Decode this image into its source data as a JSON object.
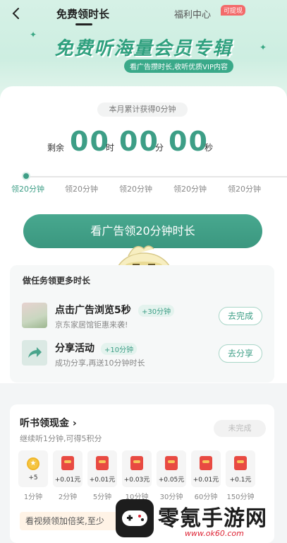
{
  "nav": {
    "back_icon": "chevron-left-icon",
    "tab_free": "免费领时长",
    "tab_welfare": "福利中心",
    "tab_badge": "可提现"
  },
  "banner": {
    "title": "免费听海量会员专辑",
    "subtitle": "看广告攒时长,收听优质VIP内容"
  },
  "timer": {
    "month_total": "本月累计获得0分钟",
    "remaining_label": "剩余",
    "hours": "00",
    "hours_unit": "时",
    "minutes": "00",
    "minutes_unit": "分",
    "seconds": "00",
    "seconds_unit": "秒"
  },
  "progress": {
    "current_step": 0,
    "steps": [
      "领20分钟",
      "领20分钟",
      "领20分钟",
      "领20分钟",
      "领20分钟"
    ]
  },
  "cta_label": "看广告领20分钟时长",
  "tasks": {
    "heading": "做任务领更多时长",
    "items": [
      {
        "title": "点击广告浏览5秒",
        "bonus": "+30分钟",
        "subtitle": "京东家居馆钜惠来袭!",
        "button": "去完成"
      },
      {
        "title": "分享活动",
        "bonus": "+10分钟",
        "subtitle": "成功分享,再送10分钟时长",
        "button": "去分享"
      }
    ]
  },
  "cash": {
    "title": "听书领现金",
    "subtitle": "继续听1分钟,可得5积分",
    "status_button": "未完成",
    "rewards": [
      {
        "value": "+5",
        "label": "1分钟",
        "kind": "coin"
      },
      {
        "value": "+0.01元",
        "label": "2分钟",
        "kind": "redpacket"
      },
      {
        "value": "+0.01元",
        "label": "5分钟",
        "kind": "redpacket"
      },
      {
        "value": "+0.03元",
        "label": "10分钟",
        "kind": "redpacket"
      },
      {
        "value": "+0.05元",
        "label": "30分钟",
        "kind": "redpacket"
      },
      {
        "value": "+0.01元",
        "label": "60分钟",
        "kind": "redpacket"
      },
      {
        "value": "+0.1元",
        "label": "150分钟",
        "kind": "redpacket"
      }
    ]
  },
  "bottom_hint": "看视频领加倍奖,至少",
  "watermark": {
    "brand": "零氪手游网",
    "url": "www.ok60.com"
  },
  "colors": {
    "accent": "#3d9e86",
    "hero_bg": "#d6f1e6",
    "red_packet": "#e84a42"
  }
}
